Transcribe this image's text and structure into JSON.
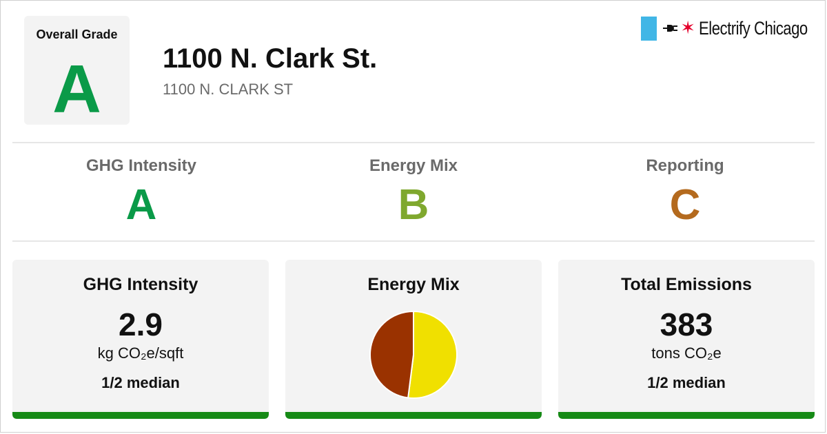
{
  "brand": {
    "name": "Electrify Chicago",
    "flag_color": "#41b6e6",
    "star_color": "#e4002b"
  },
  "overall": {
    "label": "Overall Grade",
    "grade": "A",
    "grade_color": "#0a9a48"
  },
  "building": {
    "name": "1100 N. Clark St.",
    "address": "1100 N. CLARK ST"
  },
  "grades": [
    {
      "label": "GHG Intensity",
      "grade": "A",
      "color": "#0a9a48"
    },
    {
      "label": "Energy Mix",
      "grade": "B",
      "color": "#7fa82e"
    },
    {
      "label": "Reporting",
      "grade": "C",
      "color": "#b46a1e"
    }
  ],
  "cards": {
    "ghg": {
      "title": "GHG Intensity",
      "value": "2.9",
      "unit": "kg CO₂e/sqft",
      "compare": "1/2 median",
      "bar_color": "#168a16"
    },
    "energy_mix": {
      "title": "Energy Mix",
      "bar_color": "#168a16"
    },
    "emissions": {
      "title": "Total Emissions",
      "value": "383",
      "unit": "tons CO₂e",
      "compare": "1/2 median",
      "bar_color": "#168a16"
    }
  },
  "chart_data": {
    "type": "pie",
    "slices": [
      {
        "share": 0.52,
        "color": "#f0e000"
      },
      {
        "share": 0.48,
        "color": "#9a3200"
      }
    ]
  }
}
